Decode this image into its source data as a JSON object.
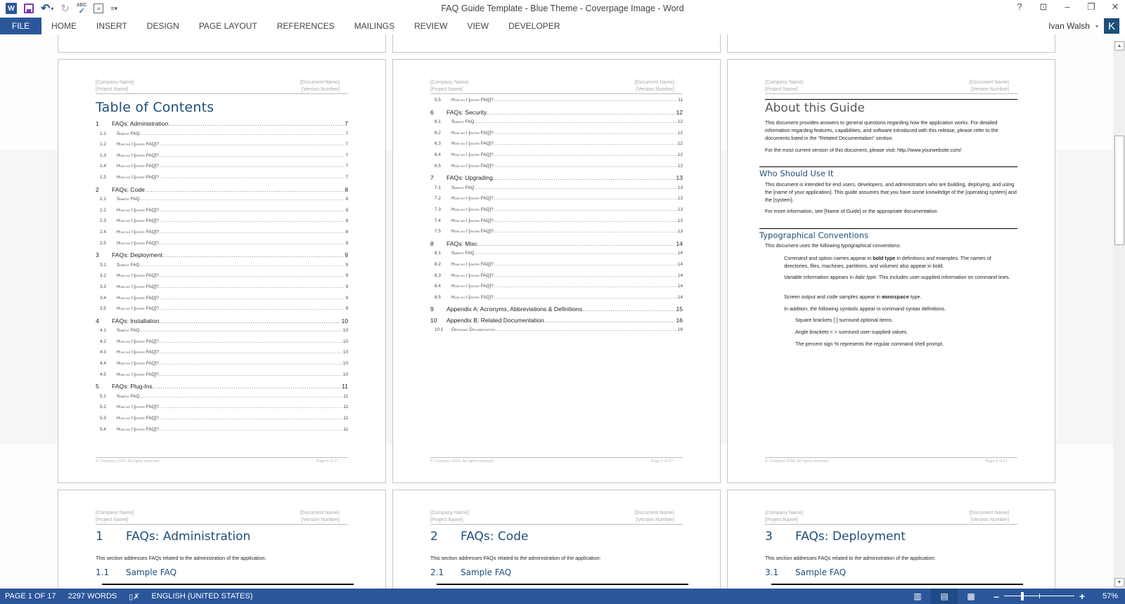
{
  "window": {
    "title": "FAQ Guide Template - Blue Theme - Coverpage Image - Word",
    "controls": {
      "help": "?",
      "ribbon_display": "⊡",
      "minimize": "–",
      "restore": "❐",
      "close": "✕"
    }
  },
  "qat": {
    "word_logo": "W",
    "undo": "↶",
    "undo_caret": "▾",
    "redo": "↻",
    "spell_abc": "ABC",
    "spell_check": "✓",
    "more": "≡▾"
  },
  "ribbon": {
    "file_label": "FILE",
    "tabs": [
      "HOME",
      "INSERT",
      "DESIGN",
      "PAGE LAYOUT",
      "REFERENCES",
      "MAILINGS",
      "REVIEW",
      "VIEW",
      "DEVELOPER"
    ],
    "user_name": "Ivan Walsh",
    "user_caret": "▾",
    "avatar_letter": "K"
  },
  "header_fields": {
    "company": "[Company Name]",
    "project": "[Project Name]",
    "document": "[Document Name]",
    "version": "[Version Number]"
  },
  "footer": {
    "copyright": "© Company 2016. All rights reserved.",
    "page4": "Page 4 of 17",
    "page5": "Page 5 of 17",
    "page6": "Page 6 of 17"
  },
  "toc": {
    "title": "Table of Contents",
    "page4_entries": [
      {
        "level": 1,
        "num": "1",
        "text": "FAQs: Administration",
        "page": "7"
      },
      {
        "level": 2,
        "num": "1.1",
        "text": "Sample FAQ",
        "page": "7"
      },
      {
        "level": 2,
        "num": "1.2",
        "text": "How do I [enter FAQ]?",
        "page": "7"
      },
      {
        "level": 2,
        "num": "1.3",
        "text": "How do I [enter FAQ]?",
        "page": "7"
      },
      {
        "level": 2,
        "num": "1.4",
        "text": "How do I [enter FAQ]?",
        "page": "7"
      },
      {
        "level": 2,
        "num": "1.5",
        "text": "How do I [enter FAQ]?",
        "page": "7"
      },
      {
        "level": 1,
        "num": "2",
        "text": "FAQs: Code",
        "page": "8"
      },
      {
        "level": 2,
        "num": "2.1",
        "text": "Sample FAQ",
        "page": "8"
      },
      {
        "level": 2,
        "num": "2.2",
        "text": "How do I [enter FAQ]?",
        "page": "8"
      },
      {
        "level": 2,
        "num": "2.3",
        "text": "How do I [enter FAQ]?",
        "page": "8"
      },
      {
        "level": 2,
        "num": "2.4",
        "text": "How do I [enter FAQ]?",
        "page": "8"
      },
      {
        "level": 2,
        "num": "2.5",
        "text": "How do I [enter FAQ]?",
        "page": "8"
      },
      {
        "level": 1,
        "num": "3",
        "text": "FAQs: Deployment",
        "page": "9"
      },
      {
        "level": 2,
        "num": "3.1",
        "text": "Sample FAQ",
        "page": "9"
      },
      {
        "level": 2,
        "num": "3.2",
        "text": "How do I [enter FAQ]?",
        "page": "9"
      },
      {
        "level": 2,
        "num": "3.3",
        "text": "How do I [enter FAQ]?",
        "page": "9"
      },
      {
        "level": 2,
        "num": "3.4",
        "text": "How do I [enter FAQ]?",
        "page": "9"
      },
      {
        "level": 2,
        "num": "3.5",
        "text": "How do I [enter FAQ]?",
        "page": "9"
      },
      {
        "level": 1,
        "num": "4",
        "text": "FAQs: Installation",
        "page": "10"
      },
      {
        "level": 2,
        "num": "4.1",
        "text": "Sample FAQ",
        "page": "10"
      },
      {
        "level": 2,
        "num": "4.2",
        "text": "How do I [enter FAQ]?",
        "page": "10"
      },
      {
        "level": 2,
        "num": "4.3",
        "text": "How do I [enter FAQ]?",
        "page": "10"
      },
      {
        "level": 2,
        "num": "4.4",
        "text": "How do I [enter FAQ]?",
        "page": "10"
      },
      {
        "level": 2,
        "num": "4.5",
        "text": "How do I [enter FAQ]?",
        "page": "10"
      },
      {
        "level": 1,
        "num": "5",
        "text": "FAQs: Plug-Ins",
        "page": "11"
      },
      {
        "level": 2,
        "num": "5.1",
        "text": "Sample FAQ",
        "page": "11"
      },
      {
        "level": 2,
        "num": "5.2",
        "text": "How do I [enter FAQ]?",
        "page": "11"
      },
      {
        "level": 2,
        "num": "5.3",
        "text": "How do I [enter FAQ]?",
        "page": "11"
      },
      {
        "level": 2,
        "num": "5.4",
        "text": "How do I [enter FAQ]?",
        "page": "11"
      }
    ],
    "page5_entries": [
      {
        "level": 2,
        "num": "5.5",
        "text": "How do I [enter FAQ]?",
        "page": "11"
      },
      {
        "level": 1,
        "num": "6",
        "text": "FAQs: Security",
        "page": "12"
      },
      {
        "level": 2,
        "num": "6.1",
        "text": "Sample FAQ",
        "page": "12"
      },
      {
        "level": 2,
        "num": "6.2",
        "text": "How do I [enter FAQ]?",
        "page": "12"
      },
      {
        "level": 2,
        "num": "6.3",
        "text": "How do I [enter FAQ]?",
        "page": "12"
      },
      {
        "level": 2,
        "num": "6.4",
        "text": "How do I [enter FAQ]?",
        "page": "12"
      },
      {
        "level": 2,
        "num": "6.5",
        "text": "How do I [enter FAQ]?",
        "page": "12"
      },
      {
        "level": 1,
        "num": "7",
        "text": "FAQs: Upgrading",
        "page": "13"
      },
      {
        "level": 2,
        "num": "7.1",
        "text": "Sample FAQ",
        "page": "13"
      },
      {
        "level": 2,
        "num": "7.2",
        "text": "How do I [enter FAQ]?",
        "page": "13"
      },
      {
        "level": 2,
        "num": "7.3",
        "text": "How do I [enter FAQ]?",
        "page": "13"
      },
      {
        "level": 2,
        "num": "7.4",
        "text": "How do I [enter FAQ]?",
        "page": "13"
      },
      {
        "level": 2,
        "num": "7.5",
        "text": "How do I [enter FAQ]?",
        "page": "13"
      },
      {
        "level": 1,
        "num": "8",
        "text": "FAQs: Misc",
        "page": "14"
      },
      {
        "level": 2,
        "num": "8.1",
        "text": "Sample FAQ",
        "page": "14"
      },
      {
        "level": 2,
        "num": "8.2",
        "text": "How do I [enter FAQ]?",
        "page": "14"
      },
      {
        "level": 2,
        "num": "8.3",
        "text": "How do I [enter FAQ]?",
        "page": "14"
      },
      {
        "level": 2,
        "num": "8.4",
        "text": "How do I [enter FAQ]?",
        "page": "14"
      },
      {
        "level": 2,
        "num": "8.5",
        "text": "How do I [enter FAQ]?",
        "page": "14"
      },
      {
        "level": 1,
        "num": "9",
        "text": "Appendix A: Acronyms, Abbreviations & Definitions",
        "page": "15"
      },
      {
        "level": 1,
        "num": "10",
        "text": "Appendix B: Related Documentation",
        "page": "16"
      },
      {
        "level": 2,
        "num": "10.1",
        "text": "Obtaining Documentation",
        "page": "16"
      }
    ]
  },
  "about": {
    "title": "About this Guide",
    "p1": "This document provides answers to general questions regarding how the application works. For detailed information regarding features, capabilities, and software introduced with this release, please refer to the documents listed in the \"Related Documentation\" section.",
    "p2": "For the most current version of this document, please visit: http://www.yourwebsite.com/",
    "who_title": "Who Should Use It",
    "who_p1": "This document is intended for end users, developers, and administrators who are building, deploying, and using the [name of your application]. This guide assumes that you have some knowledge of the [operating system] and the [system].",
    "who_p2": "For more information, see [Name of Guide] or the appropriate documentation.",
    "typo_title": "Typographical Conventions",
    "typo_intro": "This document uses the following typographical conventions:",
    "typo_bold_pre": "Command and option names appear in ",
    "typo_bold_word": "bold type",
    "typo_bold_post": " in definitions and examples. The names of directories, files, machines, partitions, and volumes also appear in bold.",
    "typo_italic_pre": "Variable information appears in ",
    "typo_italic_word": "italic type",
    "typo_italic_post": ". This includes user-supplied information on command lines.",
    "typo_mono_pre": "Screen output and code samples appear in ",
    "typo_mono_word": "monospace",
    "typo_mono_post": " type.",
    "typo_symbols": "In addition, the following symbols appear in command syntax definitions.",
    "sym1": "Square brackets [ ] surround optional items.",
    "sym2": "Angle brackets < > surround user-supplied values.",
    "sym3": "The percent sign % represents the regular command shell prompt."
  },
  "sections": [
    {
      "num": "1",
      "title": "FAQs: Administration",
      "intro": "This section addresses FAQs related to the administration of the application:",
      "sub_num": "1.1",
      "sub_title": "Sample FAQ"
    },
    {
      "num": "2",
      "title": "FAQs: Code",
      "intro": "This section addresses FAQs related to the administration of the application:",
      "sub_num": "2.1",
      "sub_title": "Sample FAQ"
    },
    {
      "num": "3",
      "title": "FAQs: Deployment",
      "intro": "This section addresses FAQs related to the administration of the application:",
      "sub_num": "3.1",
      "sub_title": "Sample FAQ"
    }
  ],
  "status": {
    "page": "PAGE 1 OF 17",
    "words": "2297 WORDS",
    "proof_icon": "📖",
    "language": "ENGLISH (UNITED STATES)",
    "zoom_minus": "–",
    "zoom_plus": "+",
    "zoom_pct": "57%",
    "zoom_level": 0.57,
    "views": {
      "read": "▥",
      "print": "▤",
      "web": "▦"
    }
  },
  "scroll": {
    "up": "▲",
    "down": "▼"
  }
}
